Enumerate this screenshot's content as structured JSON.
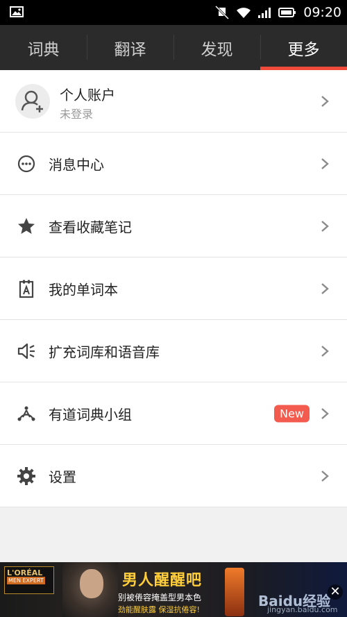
{
  "status_bar": {
    "time": "09:20",
    "icons": [
      "gallery-icon",
      "mute-icon",
      "wifi-icon",
      "signal-icon",
      "battery-icon"
    ]
  },
  "tabs": [
    {
      "label": "词典"
    },
    {
      "label": "翻译"
    },
    {
      "label": "发现"
    },
    {
      "label": "更多",
      "active": true
    }
  ],
  "account": {
    "title": "个人账户",
    "subtitle": "未登录"
  },
  "menu": [
    {
      "label": "消息中心",
      "icon": "message-center-icon"
    },
    {
      "label": "查看收藏笔记",
      "icon": "star-icon"
    },
    {
      "label": "我的单词本",
      "icon": "wordbook-icon"
    },
    {
      "label": "扩充词库和语音库",
      "icon": "speaker-icon"
    },
    {
      "label": "有道词典小组",
      "icon": "group-icon",
      "badge": "New"
    },
    {
      "label": "设置",
      "icon": "settings-gear-icon"
    }
  ],
  "ad": {
    "brand_line1": "L'ORÉAL",
    "brand_line2": "MEN EXPERT",
    "slogan": "男人醒醒吧",
    "line2": "别被倦容掩盖型男本色",
    "line3": "劲能醒肤露 保湿抗倦容!",
    "watermark": "Baidu经验",
    "watermark_url": "jingyan.baidu.com",
    "close": "✕"
  },
  "colors": {
    "accent": "#f04a3a",
    "tab_bg": "#2b2b2b",
    "badge": "#f25b4e"
  }
}
